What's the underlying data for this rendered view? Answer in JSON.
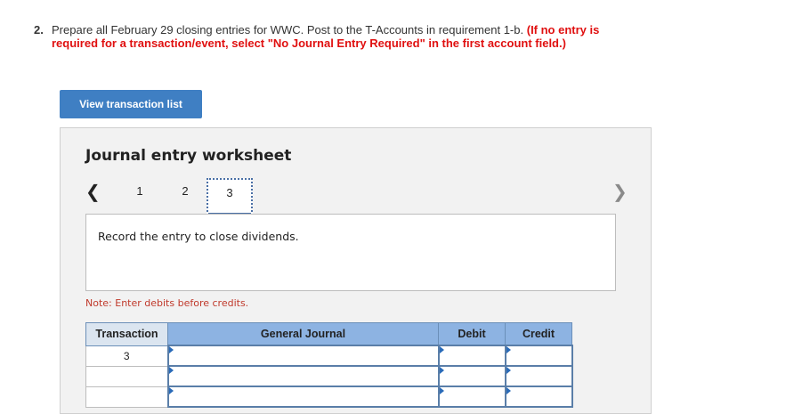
{
  "question": {
    "number": "2.",
    "text": "Prepare all February 29 closing entries for WWC. Post to the T-Accounts in requirement 1-b.",
    "hint": "(If no entry is required for a transaction/event, select \"No Journal Entry Required\" in the first account field.)"
  },
  "view_button_label": "View transaction list",
  "worksheet": {
    "title": "Journal entry worksheet",
    "pages": [
      "1",
      "2",
      "3"
    ],
    "active_page": "3",
    "prev_icon": "chevron-left-icon",
    "next_icon": "chevron-right-icon",
    "instruction": "Record the entry to close dividends.",
    "note": "Note: Enter debits before credits.",
    "columns": [
      "Transaction",
      "General Journal",
      "Debit",
      "Credit"
    ],
    "rows": [
      {
        "transaction": "3",
        "account": "",
        "debit": "",
        "credit": ""
      },
      {
        "transaction": "",
        "account": "",
        "debit": "",
        "credit": ""
      },
      {
        "transaction": "",
        "account": "",
        "debit": "",
        "credit": ""
      }
    ]
  },
  "colors": {
    "button_blue": "#3f7fc3",
    "hint_red": "#e01010",
    "header_blue": "#8db3e2"
  }
}
